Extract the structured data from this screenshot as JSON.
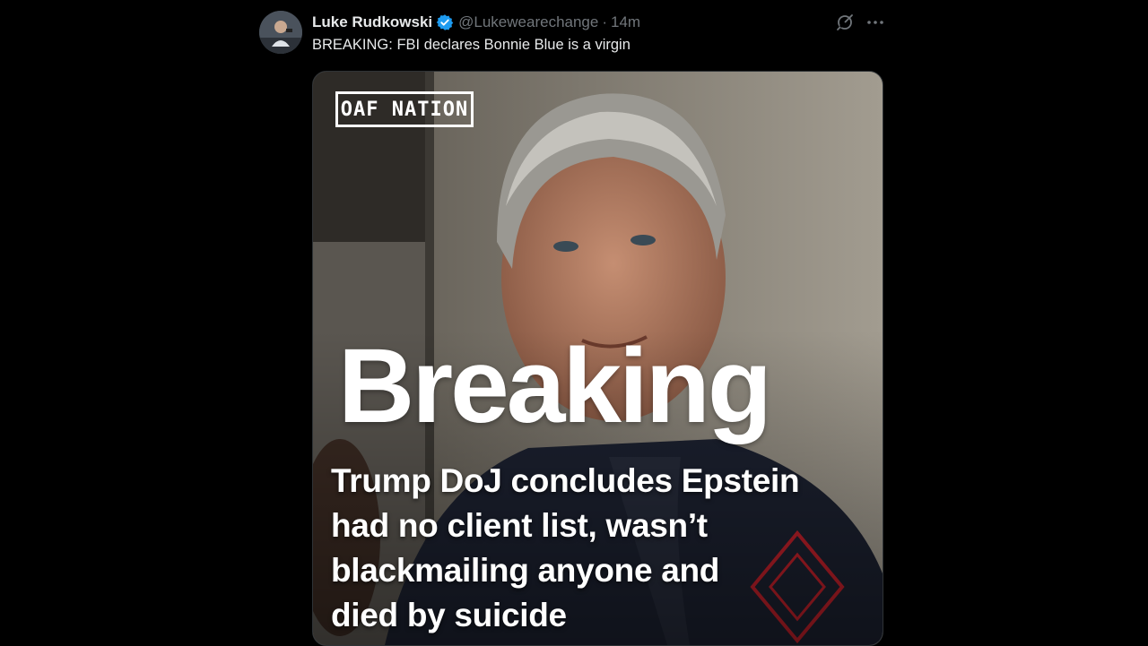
{
  "post": {
    "author": {
      "display_name": "Luke Rudkowski",
      "verified": true,
      "handle": "@Lukewearechange",
      "separator": "·",
      "timestamp": "14m"
    },
    "text": "BREAKING: FBI declares Bonnie Blue is a virgin",
    "actions": {
      "grok_icon": "grok-icon",
      "more_icon": "more-icon"
    }
  },
  "media": {
    "brand": "OAF NATION",
    "headline": "Breaking",
    "subhead_lines": [
      "Trump DoJ concludes Epstein",
      "had no client list, wasn’t",
      "blackmailing anyone and",
      "died by suicide"
    ]
  },
  "colors": {
    "background": "#000000",
    "primary_text": "#e7e9ea",
    "secondary_text": "#71767b",
    "verified_blue": "#1d9bf0"
  }
}
